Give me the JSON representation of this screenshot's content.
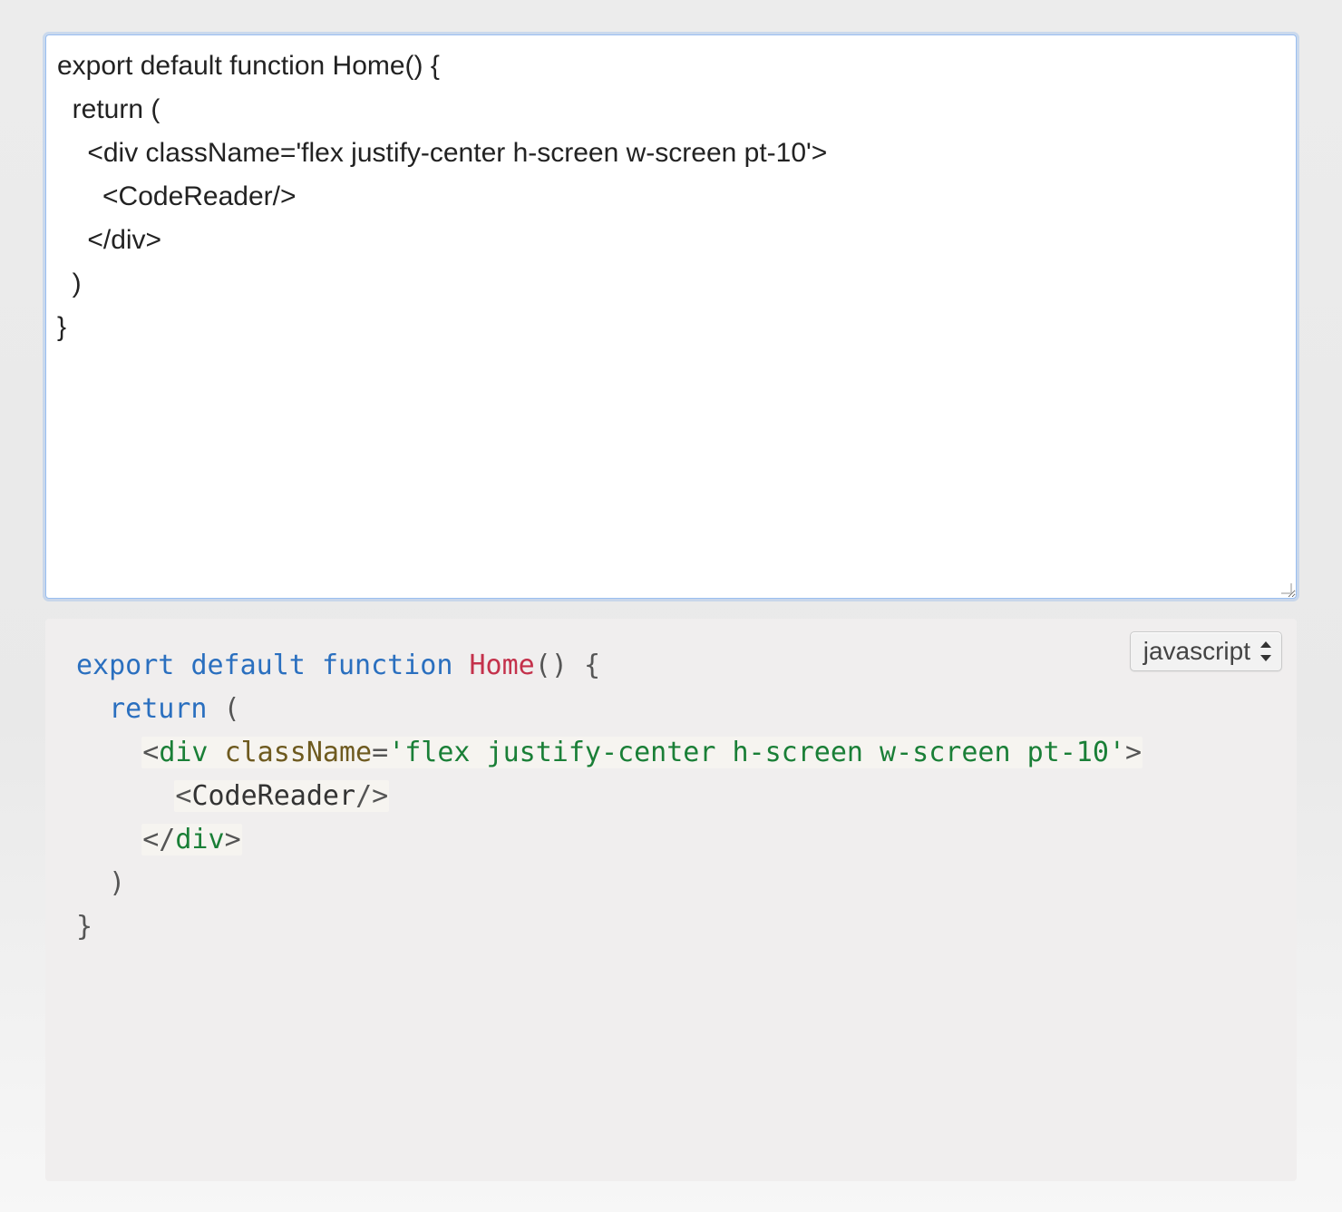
{
  "editor": {
    "value": "export default function Home() {\n  return (\n    <div className='flex justify-center h-screen w-screen pt-10'>\n      <CodeReader/>\n    </div>\n  )\n}"
  },
  "output": {
    "language_selected": "javascript",
    "tokens": {
      "export": "export",
      "default": "default",
      "function": "function",
      "home": "Home",
      "return": "return",
      "div_open_tag": "div",
      "className_attr": "className",
      "className_value": "'flex justify-center h-screen w-screen pt-10'",
      "codereader_tag": "CodeReader",
      "div_close_tag": "div"
    }
  }
}
